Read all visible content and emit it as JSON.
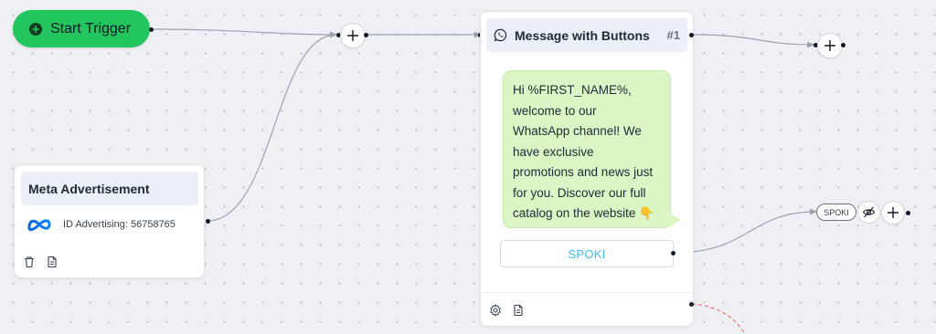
{
  "start_trigger": {
    "label": "Start Trigger",
    "icon": "plus-circle-icon",
    "color": "#22c55e"
  },
  "meta_node": {
    "title": "Meta Advertisement",
    "logo": "meta-logo-icon",
    "id_text": "ID Advertising: 56758765",
    "tools": [
      "trash-icon",
      "document-icon"
    ]
  },
  "message_node": {
    "title": "Message with Buttons",
    "index": "#1",
    "icon": "whatsapp-icon",
    "message_lines": [
      "Hi %FIRST_NAME%,",
      "welcome to our",
      "WhatsApp channel! We",
      "have exclusive",
      "promotions and news just",
      "for you. Discover our full",
      "catalog on the website 👇"
    ],
    "button_label": "SPOKI",
    "tools": [
      "gear-icon",
      "document-icon"
    ]
  },
  "branch": {
    "tag": "SPOKI",
    "visibility_icon": "eye-off-icon"
  },
  "colors": {
    "canvas": "#eef0f4",
    "bubble": "#dcf5c5",
    "button_text": "#38bdf8",
    "error_link": "#f87171"
  }
}
